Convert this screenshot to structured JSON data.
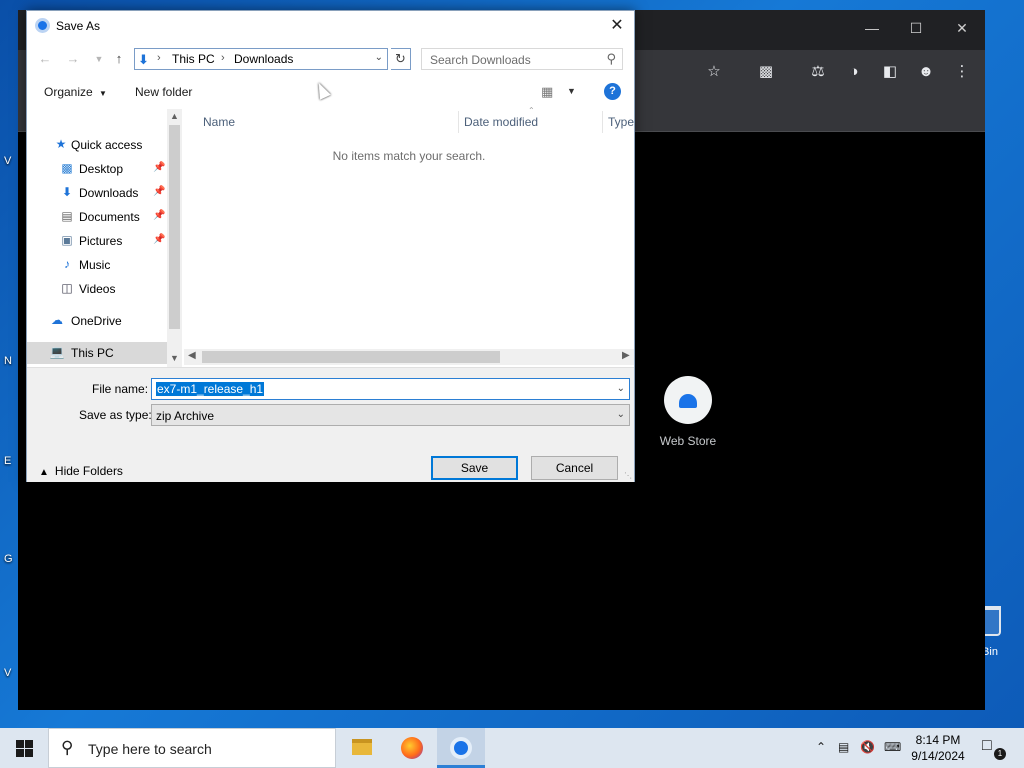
{
  "desktop": {
    "edge_letters": [
      "V",
      "N",
      "E",
      "G",
      "V"
    ],
    "recycle_bin_label": "Bin"
  },
  "browser": {
    "webstore_label": "Web Store"
  },
  "dialog": {
    "title": "Save As",
    "address": {
      "crumbs": [
        "This PC",
        "Downloads"
      ]
    },
    "search_placeholder": "Search Downloads",
    "organize_label": "Organize",
    "new_folder_label": "New folder",
    "help_label": "?",
    "nav": {
      "quick_access": "Quick access",
      "items": [
        {
          "label": "Desktop",
          "icon": "desktop-icon",
          "pinned": true
        },
        {
          "label": "Downloads",
          "icon": "download-arrow-icon",
          "pinned": true
        },
        {
          "label": "Documents",
          "icon": "documents-icon",
          "pinned": true
        },
        {
          "label": "Pictures",
          "icon": "pictures-icon",
          "pinned": true
        },
        {
          "label": "Music",
          "icon": "music-note-icon",
          "pinned": false
        },
        {
          "label": "Videos",
          "icon": "videos-icon",
          "pinned": false
        }
      ],
      "onedrive": "OneDrive",
      "this_pc": "This PC",
      "selected": "This PC"
    },
    "columns": [
      "Name",
      "Date modified",
      "Type"
    ],
    "empty_message": "No items match your search.",
    "file_name_label": "File name:",
    "file_name_value": "ex7-m1_release_h1",
    "save_type_label": "Save as type:",
    "save_type_value": "zip Archive",
    "hide_folders_label": "Hide Folders",
    "save_label": "Save",
    "cancel_label": "Cancel"
  },
  "taskbar": {
    "search_placeholder": "Type here to search",
    "apps": [
      "file-explorer",
      "firefox",
      "chrome"
    ],
    "active_app": "chrome",
    "time": "8:14 PM",
    "date": "9/14/2024",
    "notification_count": "1"
  },
  "colors": {
    "accent": "#0078d7",
    "desktop_bg": "#1679d6",
    "taskbar_bg": "#dde6f0",
    "browser_bg": "#000000"
  }
}
